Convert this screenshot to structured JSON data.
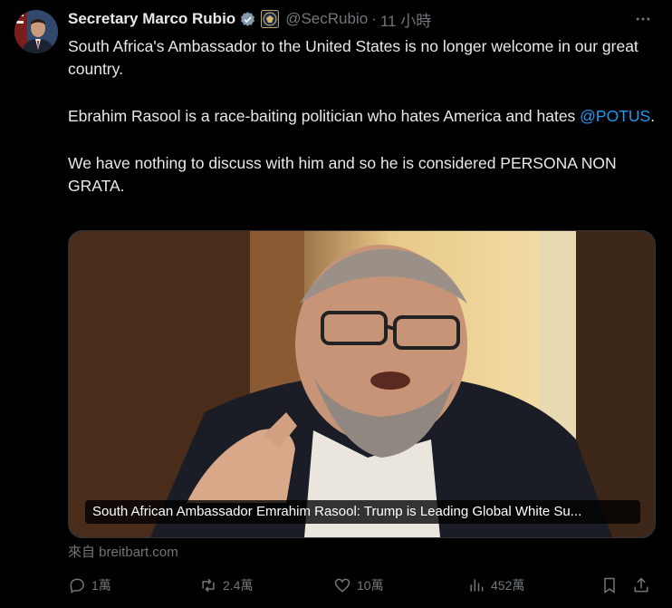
{
  "post": {
    "author_name": "Secretary Marco Rubio",
    "handle": "@SecRubio",
    "separator": "·",
    "time": "11 小時",
    "paragraph1": "South Africa's Ambassador to the United States is no longer welcome in our great country.",
    "paragraph2_before": "Ebrahim Rasool is a race-baiting politician who hates America and hates ",
    "mention": "@POTUS",
    "paragraph2_after": ".",
    "paragraph3": "We have nothing to discuss with him and so he is considered PERSONA NON GRATA."
  },
  "media": {
    "caption": "South African Ambassador Emrahim Rasool: Trump is Leading Global White Su..."
  },
  "source": "來自 breitbart.com",
  "actions": {
    "replies": "1萬",
    "reposts": "2.4萬",
    "likes": "10萬",
    "views": "452萬"
  },
  "icons": {
    "verified": "verified-badge-icon",
    "seal": "government-seal-icon",
    "more": "more-options-icon",
    "reply": "reply-icon",
    "repost": "repost-icon",
    "like": "like-icon",
    "views": "views-icon",
    "bookmark": "bookmark-icon",
    "share": "share-icon"
  },
  "colors": {
    "background": "#000000",
    "text": "#e7e9ea",
    "muted": "#71767b",
    "link": "#1d9bf0"
  }
}
